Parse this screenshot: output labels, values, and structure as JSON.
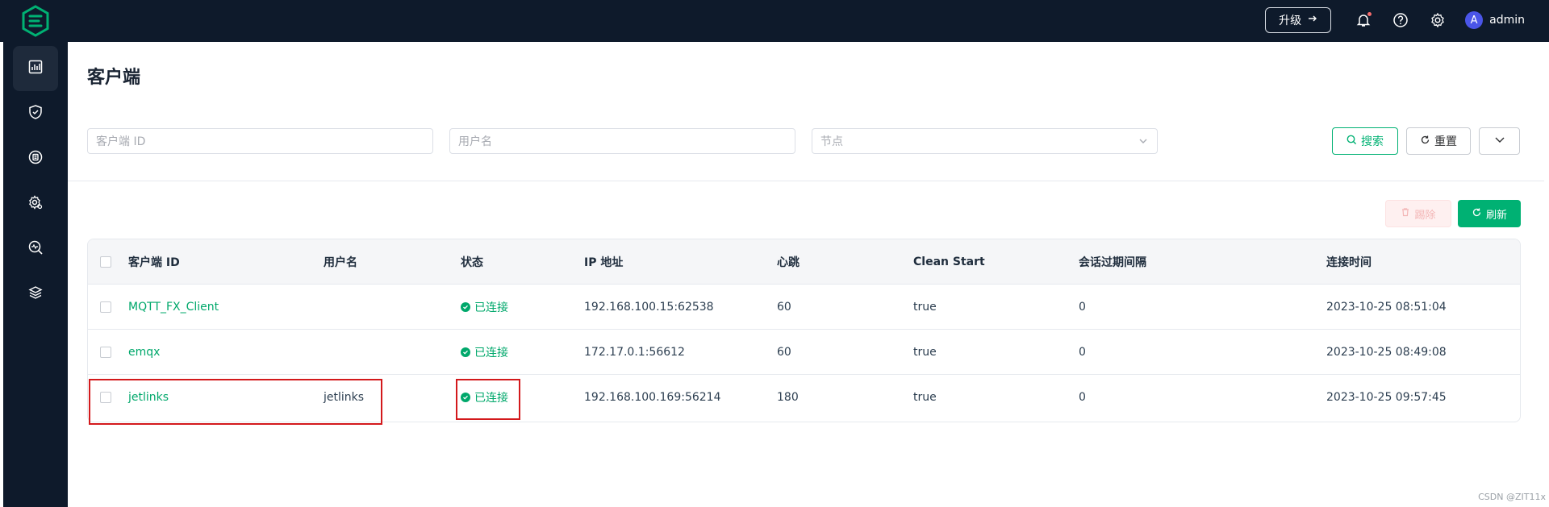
{
  "colors": {
    "brand": "#00b173",
    "nav_bg": "#0e1a2b",
    "danger": "#d3191c"
  },
  "header": {
    "upgrade_label": "升级",
    "user_initial": "A",
    "username": "admin",
    "icons": [
      "bell-icon",
      "help-icon",
      "settings-icon"
    ]
  },
  "sidebar": {
    "items": [
      {
        "name": "dashboard-icon",
        "active": true
      },
      {
        "name": "shield-icon",
        "active": false
      },
      {
        "name": "integration-icon",
        "active": false
      },
      {
        "name": "gear-icon",
        "active": false
      },
      {
        "name": "diagnose-icon",
        "active": false
      },
      {
        "name": "extensions-icon",
        "active": false
      }
    ]
  },
  "page": {
    "title": "客户端"
  },
  "filters": {
    "client_id_placeholder": "客户端 ID",
    "username_placeholder": "用户名",
    "node_placeholder": "节点",
    "search_label": "搜索",
    "reset_label": "重置"
  },
  "actions": {
    "kick_label": "踢除",
    "refresh_label": "刷新"
  },
  "table": {
    "columns": [
      "客户端 ID",
      "用户名",
      "状态",
      "IP 地址",
      "心跳",
      "Clean Start",
      "会话过期间隔",
      "连接时间"
    ],
    "rows": [
      {
        "client_id": "MQTT_FX_Client",
        "username": "",
        "status": "已连接",
        "ip": "192.168.100.15:62538",
        "keepalive": "60",
        "clean_start": "true",
        "expiry": "0",
        "connected_at": "2023-10-25 08:51:04"
      },
      {
        "client_id": "emqx",
        "username": "",
        "status": "已连接",
        "ip": "172.17.0.1:56612",
        "keepalive": "60",
        "clean_start": "true",
        "expiry": "0",
        "connected_at": "2023-10-25 08:49:08"
      },
      {
        "client_id": "jetlinks",
        "username": "jetlinks",
        "status": "已连接",
        "ip": "192.168.100.169:56214",
        "keepalive": "180",
        "clean_start": "true",
        "expiry": "0",
        "connected_at": "2023-10-25 09:57:45"
      }
    ]
  },
  "watermark": "CSDN @ZIT11x"
}
